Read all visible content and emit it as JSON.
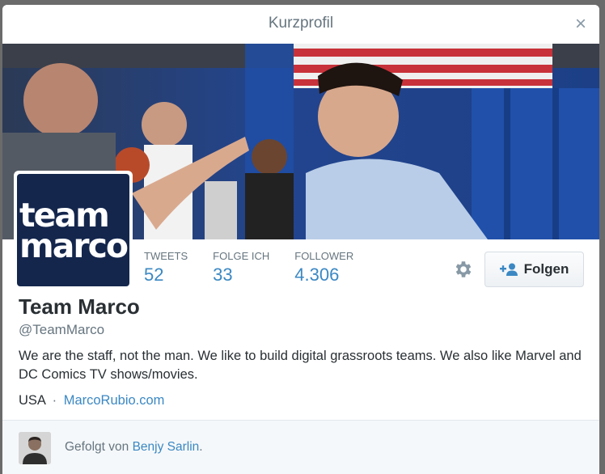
{
  "modal": {
    "title": "Kurzprofil",
    "close_label": "×"
  },
  "profile": {
    "avatar_lines": [
      "team",
      "marco"
    ],
    "name": "Team Marco",
    "handle": "@TeamMarco",
    "bio": "We are the staff, not the man. We like to build digital grassroots teams. We also like Marvel and DC Comics TV shows/movies.",
    "location": "USA",
    "separator": "·",
    "website": "MarcoRubio.com"
  },
  "stats": [
    {
      "label": "TWEETS",
      "value": "52"
    },
    {
      "label": "FOLGE ICH",
      "value": "33"
    },
    {
      "label": "FOLLOWER",
      "value": "4.306"
    }
  ],
  "actions": {
    "follow_label": "Folgen"
  },
  "footer": {
    "prefix": "Gefolgt von ",
    "user": "Benjy Sarlin",
    "suffix": "."
  },
  "colors": {
    "accent": "#3b88c3",
    "avatar_bg": "#14264c",
    "text": "#292f33",
    "muted": "#66757f"
  }
}
